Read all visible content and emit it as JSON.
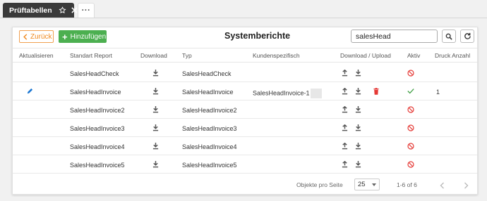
{
  "tabs": {
    "active_label": "Prüftabellen",
    "more_label": "···"
  },
  "toolbar": {
    "back_label": "Zurück",
    "add_label": "Hinzufügen",
    "title": "Systemberichte",
    "search_value": "salesHead"
  },
  "table": {
    "headers": [
      "Aktualisieren",
      "Standart Report",
      "Download",
      "Typ",
      "Kundenspezifisch",
      "Download / Upload",
      "Aktiv",
      "Druck Anzahl"
    ],
    "rows": [
      {
        "report": "SalesHeadCheck",
        "typ": "SalesHeadCheck",
        "kunden": "",
        "aktiv": false,
        "anzahl": "",
        "editable": false
      },
      {
        "report": "SalesHeadInvoice",
        "typ": "SalesHeadInvoice",
        "kunden": "SalesHeadInvoice-1",
        "aktiv": true,
        "anzahl": "1",
        "editable": true
      },
      {
        "report": "SalesHeadInvoice2",
        "typ": "SalesHeadInvoice2",
        "kunden": "",
        "aktiv": false,
        "anzahl": "",
        "editable": false
      },
      {
        "report": "SalesHeadInvoice3",
        "typ": "SalesHeadInvoice3",
        "kunden": "",
        "aktiv": false,
        "anzahl": "",
        "editable": false
      },
      {
        "report": "SalesHeadInvoice4",
        "typ": "SalesHeadInvoice4",
        "kunden": "",
        "aktiv": false,
        "anzahl": "",
        "editable": false
      },
      {
        "report": "SalesHeadInvoice5",
        "typ": "SalesHeadInvoice5",
        "kunden": "",
        "aktiv": false,
        "anzahl": "",
        "editable": false
      }
    ]
  },
  "footer": {
    "per_page_label": "Objekte pro Seite",
    "per_page_value": "25",
    "range": "1-6 of 6"
  },
  "colors": {
    "accent_orange": "#f08a20",
    "add_green": "#4caf50",
    "inactive_red": "#e53935",
    "active_green": "#43a047",
    "edit_blue": "#1976d2",
    "delete_red": "#e53935"
  },
  "icons": {
    "tab": [
      "star-outline-icon",
      "close-icon"
    ],
    "toolbar": [
      "chevron-left-icon",
      "plus-icon",
      "search-icon",
      "refresh-icon"
    ],
    "rows": [
      "edit-pencil-icon",
      "download-icon",
      "upload-icon",
      "delete-trash-icon",
      "check-icon",
      "block-icon"
    ],
    "footer": [
      "chevron-left-icon",
      "chevron-right-icon",
      "caret-down-icon"
    ]
  }
}
